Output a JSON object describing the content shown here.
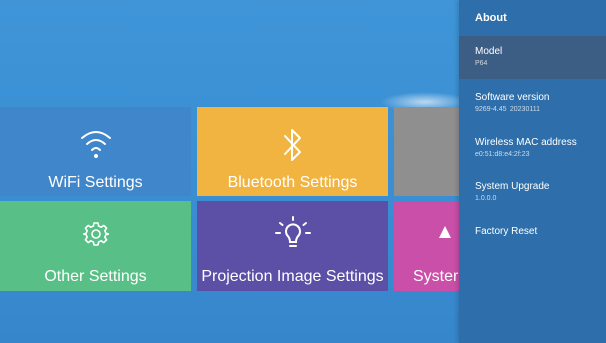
{
  "tiles": {
    "wifi": {
      "label": "WiFi Settings",
      "icon": "wifi-icon",
      "color": "#3f86cb"
    },
    "bluetooth": {
      "label": "Bluetooth Settings",
      "icon": "bluetooth-icon",
      "color": "#f2b441"
    },
    "other": {
      "label": "Other Settings",
      "icon": "gear-icon",
      "color": "#58c087"
    },
    "projection": {
      "label": "Projection Image Settings",
      "icon": "lightbulb-icon",
      "color": "#5b4fa6"
    },
    "system": {
      "label": "Syster",
      "icon": "system-icon",
      "color": "#c94fa8"
    }
  },
  "about_panel": {
    "title": "About",
    "items": [
      {
        "label": "Model",
        "value": "P64"
      },
      {
        "label": "Software version",
        "value": "9269-4.45  20230111"
      },
      {
        "label": "Wireless MAC address",
        "value": "e0:51:d8:e4:2f:23"
      },
      {
        "label": "System Upgrade",
        "value": "1.0.0.0"
      },
      {
        "label": "Factory Reset",
        "value": ""
      }
    ],
    "selected_index": 0
  },
  "colors": {
    "background": "#3d8fd3",
    "panel": "#2e6eaa",
    "panel_selected": "#3d5e84"
  }
}
